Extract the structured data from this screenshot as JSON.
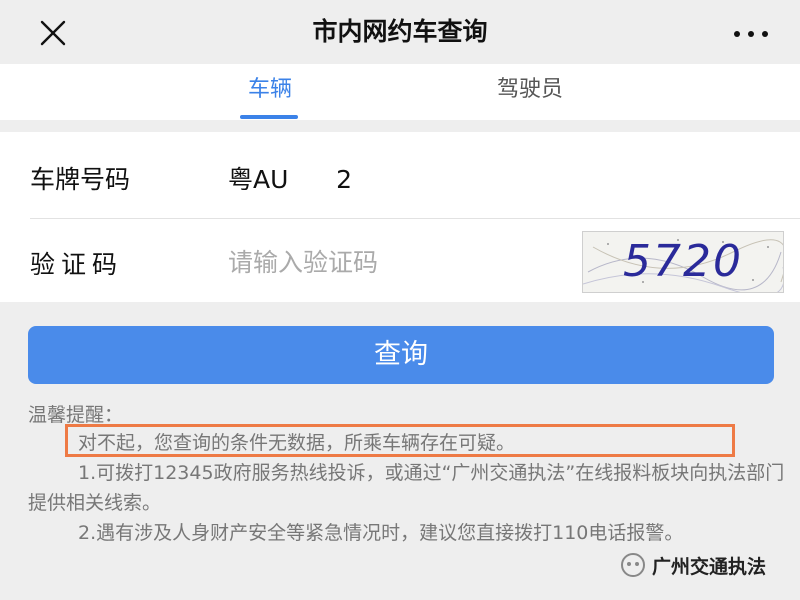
{
  "header": {
    "title": "市内网约车查询",
    "close_icon": "close-icon",
    "more_icon": "more-icon"
  },
  "tabs": [
    {
      "label": "车辆",
      "active": true
    },
    {
      "label": "驾驶员",
      "active": false
    }
  ],
  "form": {
    "plate_label": "车牌号码",
    "plate_value": "粤AU      2",
    "captcha_label": "验证码",
    "captcha_placeholder": "请输入验证码",
    "captcha_code": "5720"
  },
  "query_button_label": "查询",
  "notice": {
    "title": "温馨提醒：",
    "line_1": "对不起，您查询的条件无数据，所乘车辆存在可疑。",
    "line_2": "1.可拨打12345政府服务热线投诉，或通过“广州交通执法”在线报料板块向执法部门提供相关线索。",
    "line_3": "2.遇有涉及人身财产安全等紧急情况时，建议您直接拨打110电话报警。"
  },
  "watermark": {
    "text": "广州交通执法",
    "logo_icon": "wechat-official-account-icon"
  },
  "colors": {
    "accent": "#3b82e8",
    "button": "#4a8bea",
    "highlight": "#ee7a45",
    "background": "#eeeeee"
  }
}
